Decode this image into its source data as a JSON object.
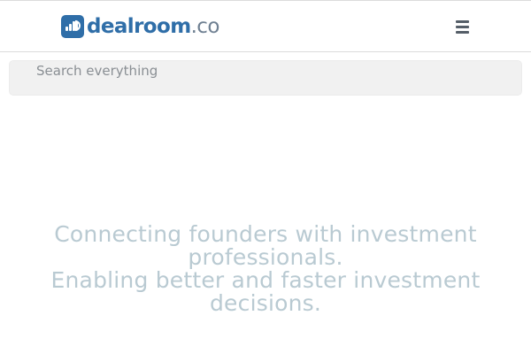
{
  "header": {
    "logo": {
      "main": "dealroom",
      "tld": ".co",
      "brand_color": "#2f6ea8",
      "tld_color": "#6f8092"
    },
    "menu_icon": "hamburger-menu-icon"
  },
  "search": {
    "placeholder": "Search everything",
    "value": ""
  },
  "tagline": {
    "line1": "Connecting founders with investment professionals.",
    "line2": "Enabling better and faster investment decisions.",
    "color": "#b9cad2"
  }
}
